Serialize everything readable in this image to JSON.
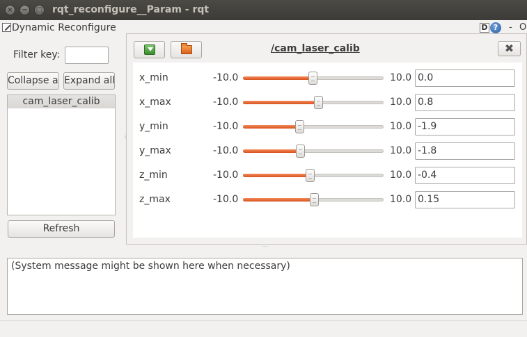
{
  "window": {
    "title": "rqt_reconfigure__Param - rqt",
    "close_glyph": "×",
    "min_glyph": "−",
    "max_glyph": "□"
  },
  "plugin": {
    "title": "Dynamic Reconfigure",
    "d_button": "D",
    "help_button": "?",
    "min_button": "-",
    "close_button": "O"
  },
  "sidebar": {
    "filter_label": "Filter key:",
    "filter_value": "",
    "collapse_label": "Collapse all",
    "expand_label": "Expand all",
    "nodes": [
      "cam_laser_calib"
    ],
    "refresh_label": "Refresh"
  },
  "editor": {
    "node_name": "/cam_laser_calib",
    "close_glyph": "✖",
    "params": [
      {
        "name": "x_min",
        "min": "-10.0",
        "max": "10.0",
        "value": "0.0",
        "fraction": 0.5
      },
      {
        "name": "x_max",
        "min": "-10.0",
        "max": "10.0",
        "value": "0.8",
        "fraction": 0.54
      },
      {
        "name": "y_min",
        "min": "-10.0",
        "max": "10.0",
        "value": "-1.9",
        "fraction": 0.405
      },
      {
        "name": "y_max",
        "min": "-10.0",
        "max": "10.0",
        "value": "-1.8",
        "fraction": 0.41
      },
      {
        "name": "z_min",
        "min": "-10.0",
        "max": "10.0",
        "value": "-0.4",
        "fraction": 0.48
      },
      {
        "name": "z_max",
        "min": "-10.0",
        "max": "10.0",
        "value": "0.15",
        "fraction": 0.5075
      }
    ]
  },
  "messages": {
    "text": "(System message might be shown here when necessary)"
  },
  "colors": {
    "slider_fill": "#e0622a",
    "title_bar": "#3c3b37"
  }
}
